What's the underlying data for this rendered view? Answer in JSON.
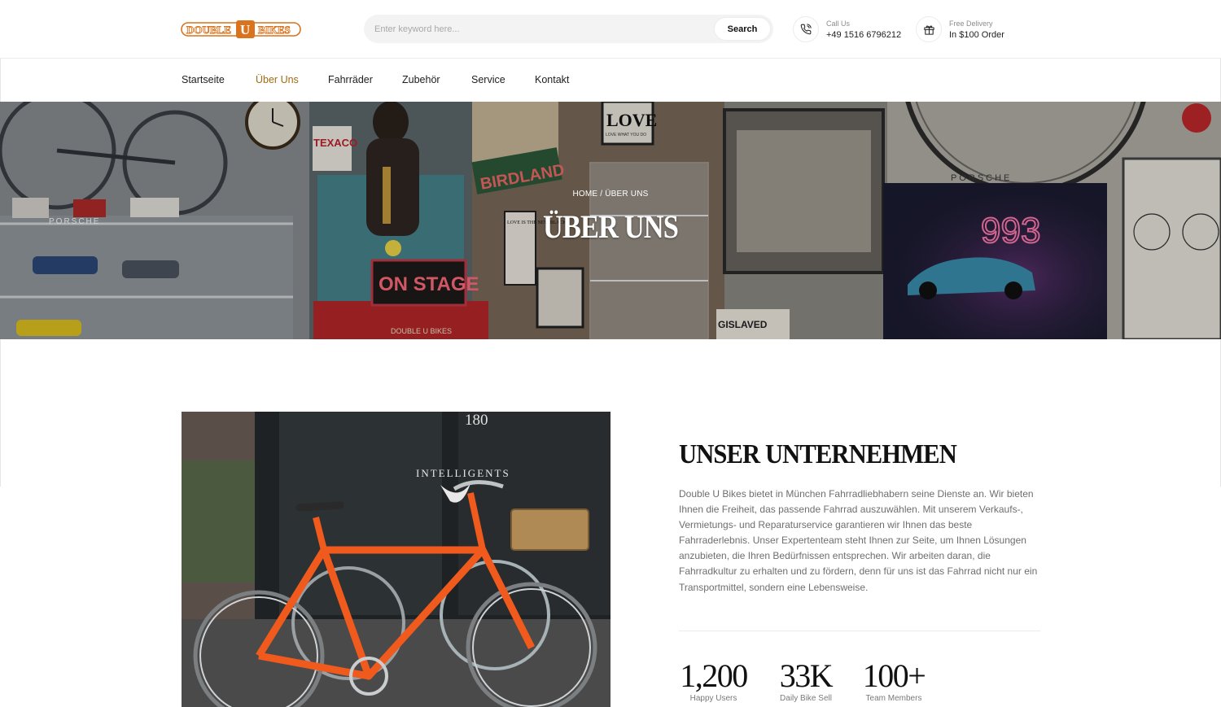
{
  "brand": {
    "logo_text_left": "DOUBLE",
    "logo_text_mid": "U",
    "logo_text_right": "BIKES",
    "accent_color": "#a06a12",
    "logo_color": "#d9731e"
  },
  "search": {
    "placeholder": "Enter keyword here...",
    "value": "",
    "button_label": "Search"
  },
  "contacts": [
    {
      "icon": "phone-icon",
      "label": "Call Us",
      "value": "+49 1516 6796212"
    },
    {
      "icon": "gift-icon",
      "label": "Free Delivery",
      "value": "In $100 Order"
    }
  ],
  "nav": {
    "items": [
      {
        "label": "Startseite",
        "active": false
      },
      {
        "label": "Über Uns",
        "active": true
      },
      {
        "label": "Fahrräder",
        "active": false
      },
      {
        "label": "Zubehör",
        "active": false
      },
      {
        "label": "Service",
        "active": false
      },
      {
        "label": "Kontakt",
        "active": false
      }
    ]
  },
  "hero": {
    "breadcrumb_home": "HOME",
    "breadcrumb_sep": "/",
    "breadcrumb_current": "ÜBER UNS",
    "title": "ÜBER UNS",
    "decor": {
      "sign_on_stage": "ON STAGE",
      "sign_birdland": "BIRDLAND",
      "sign_texaco": "TEXACO",
      "porsche_left": "PORSCHE",
      "porsche_right": "PORSCHE",
      "calendar_number": "993",
      "gislaved": "GISLAVED",
      "double_u_bikes": "DOUBLE U BIKES",
      "love": "LOVE",
      "love_sub": "LOVE WHAT YOU DO",
      "love_is": "LOVE IS THE NEW BLACK"
    }
  },
  "about": {
    "photo_decor": {
      "number": "180",
      "shop_sign": "INTELLIGENTS"
    },
    "title": "UNSER UNTERNEHMEN",
    "text": "Double U Bikes bietet in München Fahrradliebhabern seine Dienste an. Wir bieten Ihnen die Freiheit, das passende Fahrrad auszuwählen. Mit unserem Verkaufs-, Vermietungs- und Reparaturservice garantieren wir Ihnen das beste Fahrraderlebnis. Unser Expertenteam steht Ihnen zur Seite, um Ihnen Lösungen anzubieten, die Ihren Bedürfnissen entsprechen. Wir arbeiten daran, die Fahrradkultur zu erhalten und zu fördern, denn für uns ist das Fahrrad nicht nur ein Transportmittel, sondern eine Lebensweise.",
    "stats": [
      {
        "value": "1,200",
        "label": "Happy Users"
      },
      {
        "value": "33K",
        "label": "Daily Bike Sell"
      },
      {
        "value": "100+",
        "label": "Team Members"
      }
    ]
  }
}
